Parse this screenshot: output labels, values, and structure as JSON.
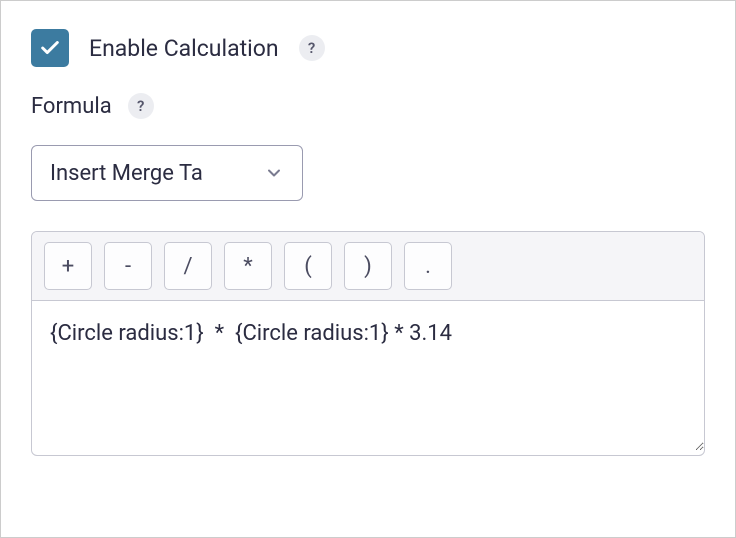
{
  "enable": {
    "checked": true,
    "label": "Enable Calculation",
    "help": "?"
  },
  "formula": {
    "label": "Formula",
    "help": "?"
  },
  "mergeTag": {
    "selected": "Insert Merge Ta"
  },
  "operators": [
    "+",
    "-",
    "/",
    "*",
    "(",
    ")",
    "."
  ],
  "formulaValue": "{Circle radius:1}  *  {Circle radius:1} * 3.14"
}
